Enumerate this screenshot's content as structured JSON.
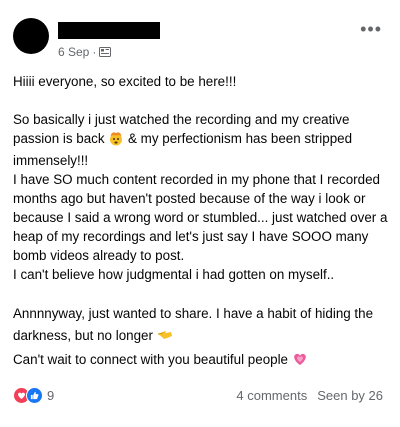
{
  "post": {
    "date": "6 Sep",
    "separator": "·",
    "more_label": "•••",
    "paragraphs": {
      "p1": "Hiiii everyone, so excited to be here!!!",
      "p2a": "So basically i just watched the recording and my creative passion is back",
      "p2b": "& my perfectionism has been stripped immensely!!!",
      "p3": "I have SO much content recorded in my phone that I recorded months ago but haven't posted because of the way i look or because I said a wrong word or stumbled... just watched over a heap of my recordings and let's just say I have SOOO many bomb videos already to post.",
      "p4": "I can't believe how judgmental i had gotten on myself..",
      "p5": "Annnnyway, just wanted to share. I have a habit of hiding the darkness, but no longer",
      "p6": "Can't wait to connect with you beautiful people"
    },
    "emojis": {
      "e1": "exploding-head-emoji",
      "e2": "backhand-index-left-emoji",
      "e3": "growing-heart-emoji"
    }
  },
  "footer": {
    "reaction_count": "9",
    "comments": "4 comments",
    "seen": "Seen by 26"
  },
  "colors": {
    "love": "#f33e58",
    "like": "#1877f2",
    "muted": "#65676b"
  }
}
